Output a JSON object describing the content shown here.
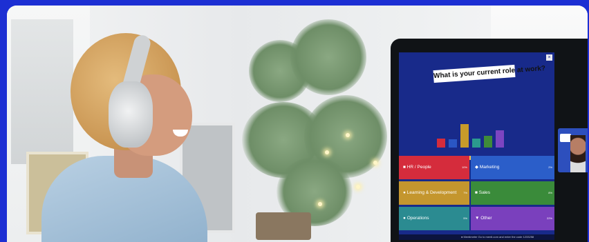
{
  "poll": {
    "question": "What is your current role at work?",
    "close_glyph": "×",
    "footer": "● Mentimeter  Go to menti.com and enter the code 1233258"
  },
  "chart_data": {
    "type": "bar",
    "categories": [
      "HR / People",
      "Learning & Development",
      "Operations",
      "Marketing",
      "Sales",
      "Other"
    ],
    "values": [
      3,
      2,
      8,
      3,
      4,
      6
    ],
    "colors": [
      "#d52c3c",
      "#2a56c4",
      "#c79b2a",
      "#2b9b8e",
      "#3f8b3a",
      "#7c45c1"
    ]
  },
  "tiles": [
    {
      "label": "HR / People",
      "count": "10%",
      "color": "#d52c3c",
      "icon": "■"
    },
    {
      "label": "Marketing",
      "count": "2%",
      "color": "#2b5ec9",
      "icon": "◆"
    },
    {
      "label": "Learning & Development",
      "count": "7%",
      "color": "#c4962e",
      "icon": "●"
    },
    {
      "label": "Sales",
      "count": "8%",
      "color": "#3a8b3a",
      "icon": "■"
    },
    {
      "label": "Operations",
      "count": "5%",
      "color": "#2b8b91",
      "icon": "●"
    },
    {
      "label": "Other",
      "count": "22%",
      "color": "#7a40bd",
      "icon": "▼"
    }
  ],
  "video": {
    "logo_text": "Mentimeter"
  }
}
